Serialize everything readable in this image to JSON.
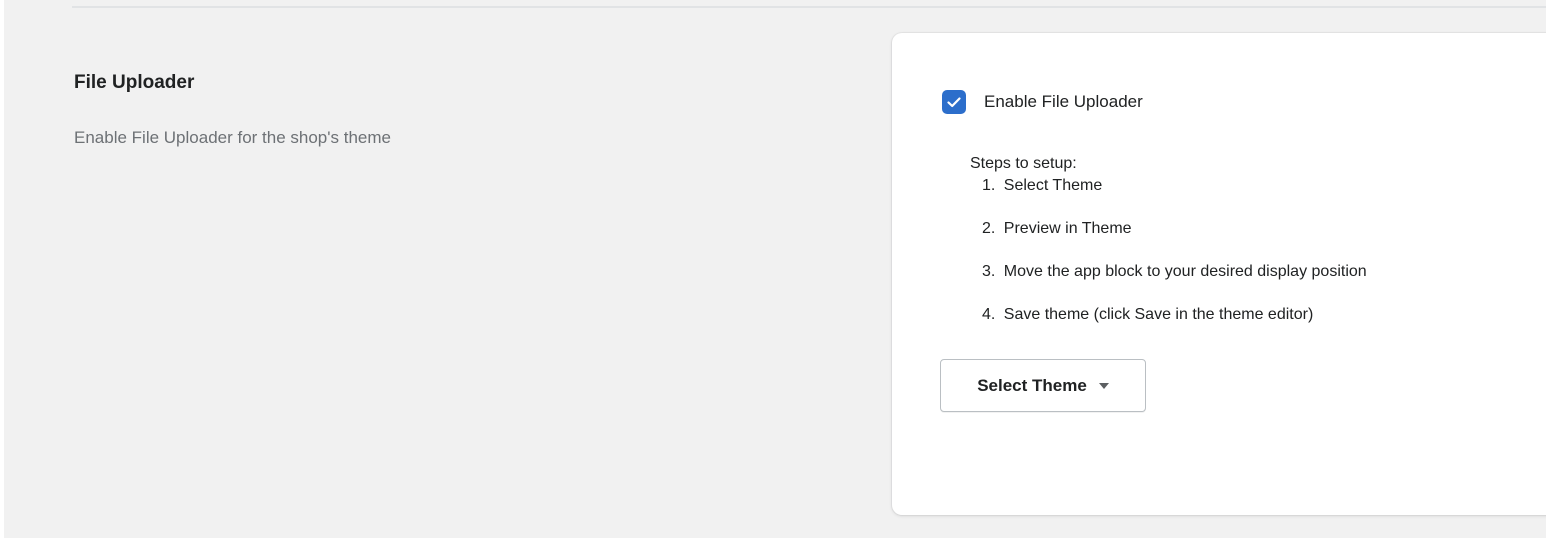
{
  "section": {
    "title": "File Uploader",
    "description": "Enable File Uploader for the shop's theme"
  },
  "card": {
    "checkbox": {
      "label": "Enable File Uploader",
      "checked": true,
      "color": "#2c6ecb"
    },
    "steps_heading": "Steps to setup:",
    "steps": [
      {
        "num": "1.",
        "text": "Select Theme"
      },
      {
        "num": "2.",
        "text": "Preview in Theme"
      },
      {
        "num": "3.",
        "text": "Move the app block to your desired display position"
      },
      {
        "num": "4.",
        "text": "Save theme (click Save in the theme editor)"
      }
    ],
    "select_button": {
      "label": "Select Theme",
      "icon": "caret-down-icon"
    }
  }
}
